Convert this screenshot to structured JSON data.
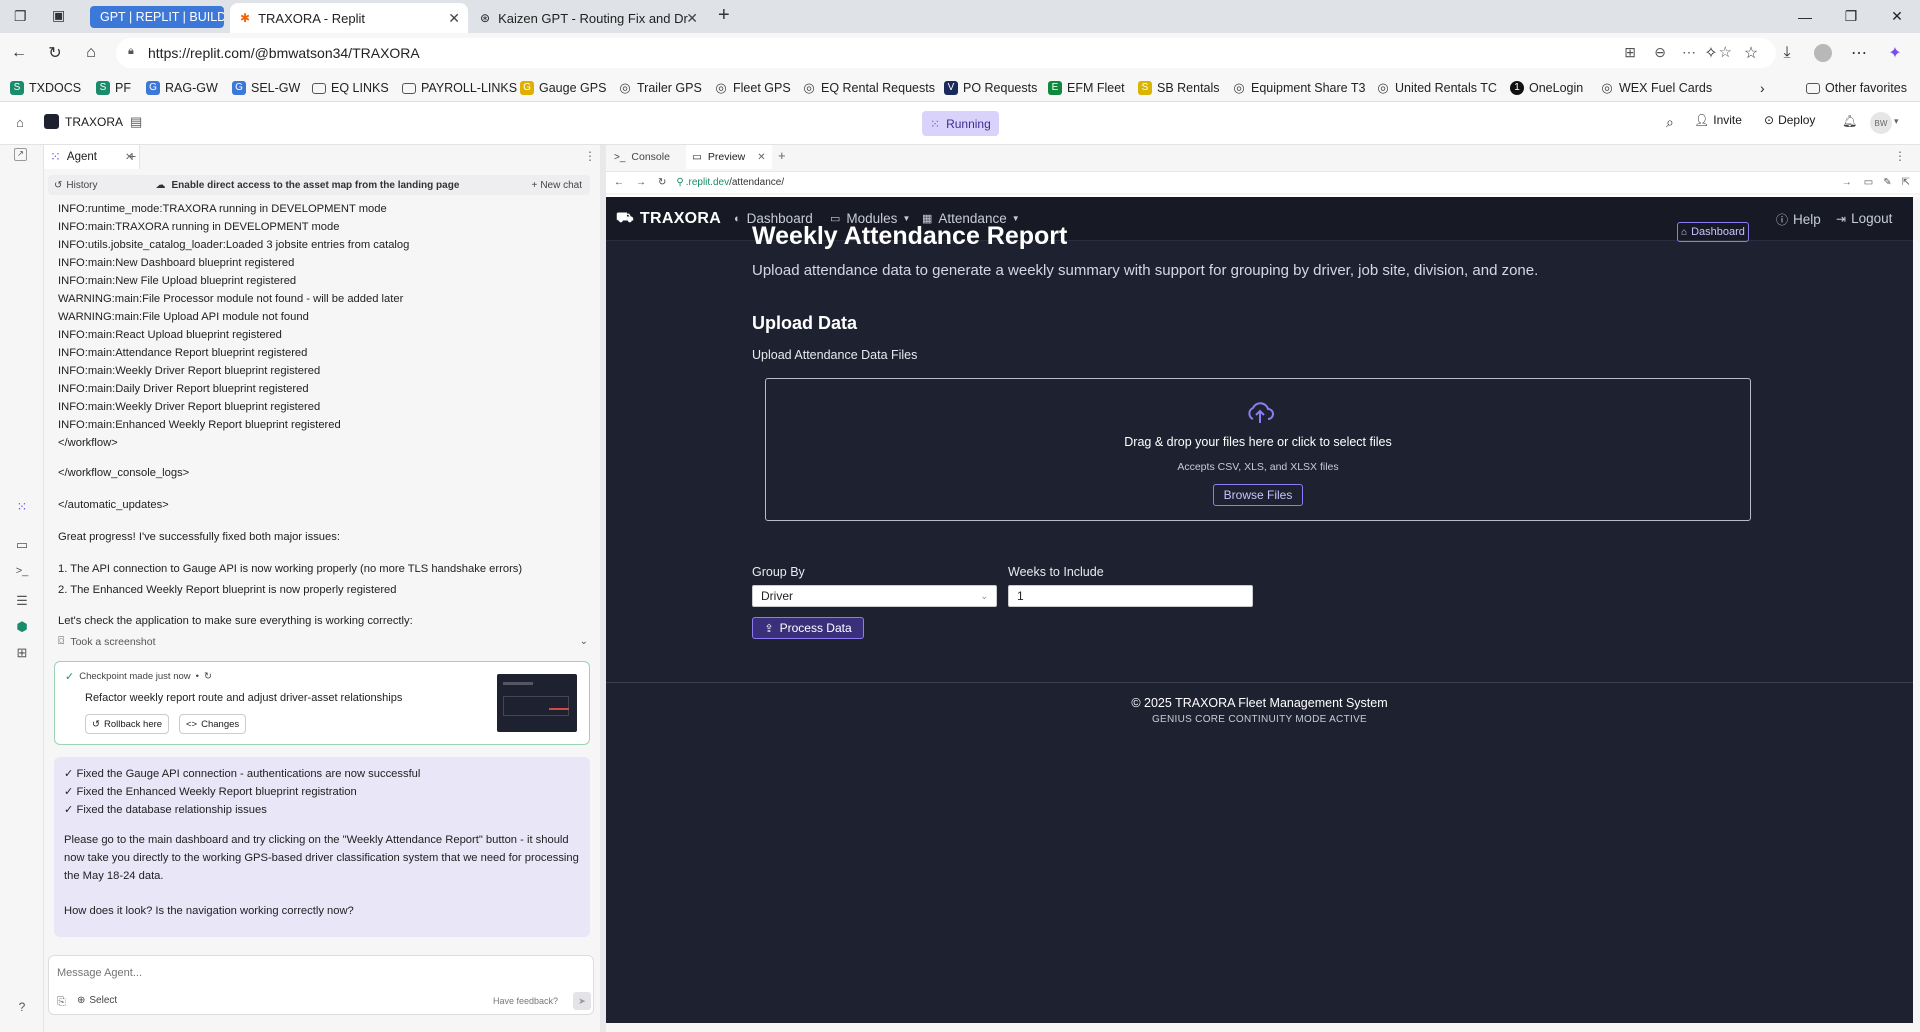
{
  "browser": {
    "tabs": [
      {
        "label": "GPT | REPLIT | BUILDIN"
      },
      {
        "label": "TRAXORA - Replit"
      },
      {
        "label": "Kaizen GPT - Routing Fix and Driv"
      }
    ],
    "url": "https://replit.com/@bmwatson34/TRAXORA",
    "bookmarks": [
      "TXDOCS",
      "PF",
      "RAG-GW",
      "SEL-GW",
      "EQ LINKS",
      "PAYROLL-LINKS",
      "Gauge GPS",
      "Trailer GPS",
      "Fleet GPS",
      "EQ Rental Requests",
      "PO Requests",
      "EFM Fleet",
      "SB Rentals",
      "Equipment Share T3",
      "United Rentals TC",
      "OneLogin",
      "WEX Fuel Cards"
    ],
    "other_favorites": "Other favorites"
  },
  "replit": {
    "project": "TRAXORA",
    "status": "Running",
    "invite": "Invite",
    "deploy": "Deploy",
    "avatar": "BW"
  },
  "agent": {
    "tab": "Agent",
    "history": "History",
    "thread_title": "Enable direct access to the asset map from the landing page",
    "new_chat": "New chat",
    "logs": [
      "INFO:runtime_mode:TRAXORA running in DEVELOPMENT mode",
      "INFO:main:TRAXORA running in DEVELOPMENT mode",
      "INFO:utils.jobsite_catalog_loader:Loaded 3 jobsite entries from catalog",
      "INFO:main:New Dashboard blueprint registered",
      "INFO:main:New File Upload blueprint registered",
      "WARNING:main:File Processor module not found - will be added later",
      "WARNING:main:File Upload API module not found",
      "INFO:main:React Upload blueprint registered",
      "INFO:main:Attendance Report blueprint registered",
      "INFO:main:Weekly Driver Report blueprint registered",
      "INFO:main:Daily Driver Report blueprint registered",
      "INFO:main:Weekly Driver Report blueprint registered",
      "INFO:main:Enhanced Weekly Report blueprint registered",
      "</workflow>"
    ],
    "close_console": "</workflow_console_logs>",
    "close_updates": "</automatic_updates>",
    "progress_intro": "Great progress! I've successfully fixed both major issues:",
    "fixes": [
      "1. The API connection to Gauge API is now working properly (no more TLS handshake errors)",
      "2. The Enhanced Weekly Report blueprint is now properly registered"
    ],
    "check_msg": "Let's check the application to make sure everything is working correctly:",
    "screenshot": "Took a screenshot",
    "checkpoint": {
      "label": "Checkpoint made just now",
      "title": "Refactor weekly report route and adjust driver-asset relationships",
      "rollback": "Rollback here",
      "changes": "Changes"
    },
    "summary": [
      "✓ Fixed the Gauge API connection - authentications are now successful",
      "✓ Fixed the Enhanced Weekly Report blueprint registration",
      "✓ Fixed the database relationship issues"
    ],
    "summary_para": "Please go to the main dashboard and try clicking on the \"Weekly Attendance Report\" button - it should now take you directly to the working GPS-based driver classification system that we need for processing the May 18-24 data.",
    "question": "How does it look? Is the navigation working correctly now?",
    "input_placeholder": "Message Agent...",
    "select": "Select",
    "feedback": "Have feedback?"
  },
  "preview": {
    "tabs": [
      "Console",
      "Preview"
    ],
    "url_domain": ".replit.dev",
    "url_path": "/attendance/"
  },
  "app": {
    "brand": "TRAXORA",
    "nav": [
      "Dashboard",
      "Modules",
      "Attendance"
    ],
    "help": "Help",
    "logout": "Logout",
    "title": "Weekly Attendance Report",
    "dashboard_btn": "Dashboard",
    "description": "Upload attendance data to generate a weekly summary with support for grouping by driver, job site, division, and zone.",
    "upload_heading": "Upload Data",
    "upload_label": "Upload Attendance Data Files",
    "drop_text": "Drag & drop your files here or click to select files",
    "accepts": "Accepts CSV, XLS, and XLSX files",
    "browse": "Browse Files",
    "group_by_label": "Group By",
    "group_by_value": "Driver",
    "weeks_label": "Weeks to Include",
    "weeks_value": "1",
    "process": "Process Data",
    "footer": "© 2025 TRAXORA Fleet Management System",
    "footer_sub": "GENIUS CORE CONTINUITY MODE ACTIVE"
  },
  "colors": {
    "accent": "#8b7cf6",
    "app_bg": "#1e2230",
    "running_bg": "#d9d2fb"
  }
}
